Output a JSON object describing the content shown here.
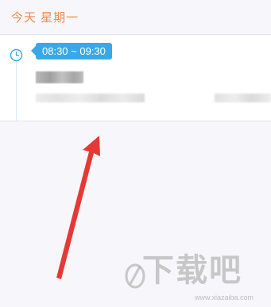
{
  "header": {
    "title": "今天 星期一"
  },
  "event": {
    "time_range": "08:30 ~ 09:30",
    "clock_icon": "clock-icon"
  },
  "colors": {
    "accent_orange": "#f08a4b",
    "badge_blue": "#3aa8e8",
    "arrow_red": "#e53935",
    "background": "#f7f6fa"
  },
  "watermark": {
    "brand": "下载吧",
    "url": "www.xiazaiba.com"
  }
}
